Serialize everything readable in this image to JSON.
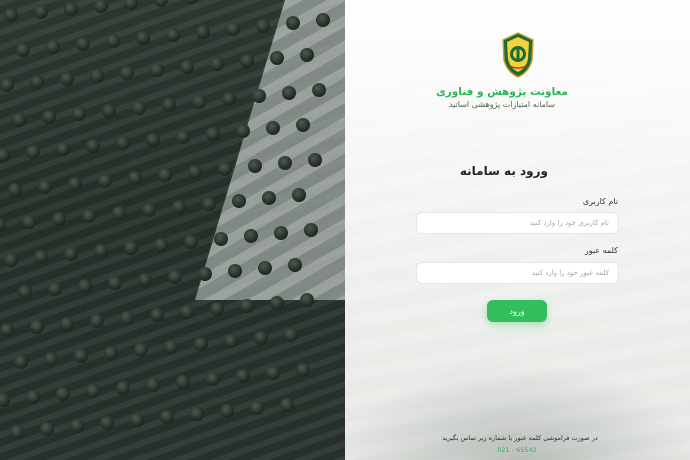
{
  "org": {
    "title": "معاونت پژوهش و فناوری",
    "subtitle": "سامانه امتیازات پژوهشی اساتید"
  },
  "login": {
    "heading": "ورود به سامانه",
    "username_label": "نام کاربری",
    "username_placeholder": "نام کاربری خود را وارد کنید",
    "username_value": "",
    "password_label": "کلمه عبور",
    "password_placeholder": "کلمه عبور خود را وارد کنید",
    "password_value": "",
    "submit_label": "ورود"
  },
  "footer": {
    "forgot_text": "در صورت فراموشی کلمه عبور با شماره زیر تماس بگیرید",
    "phone": "021 - 65542"
  },
  "colors": {
    "accent": "#33bd5c",
    "title_green": "#2fb35a"
  },
  "icons": {
    "logo": "police-emblem-icon"
  }
}
